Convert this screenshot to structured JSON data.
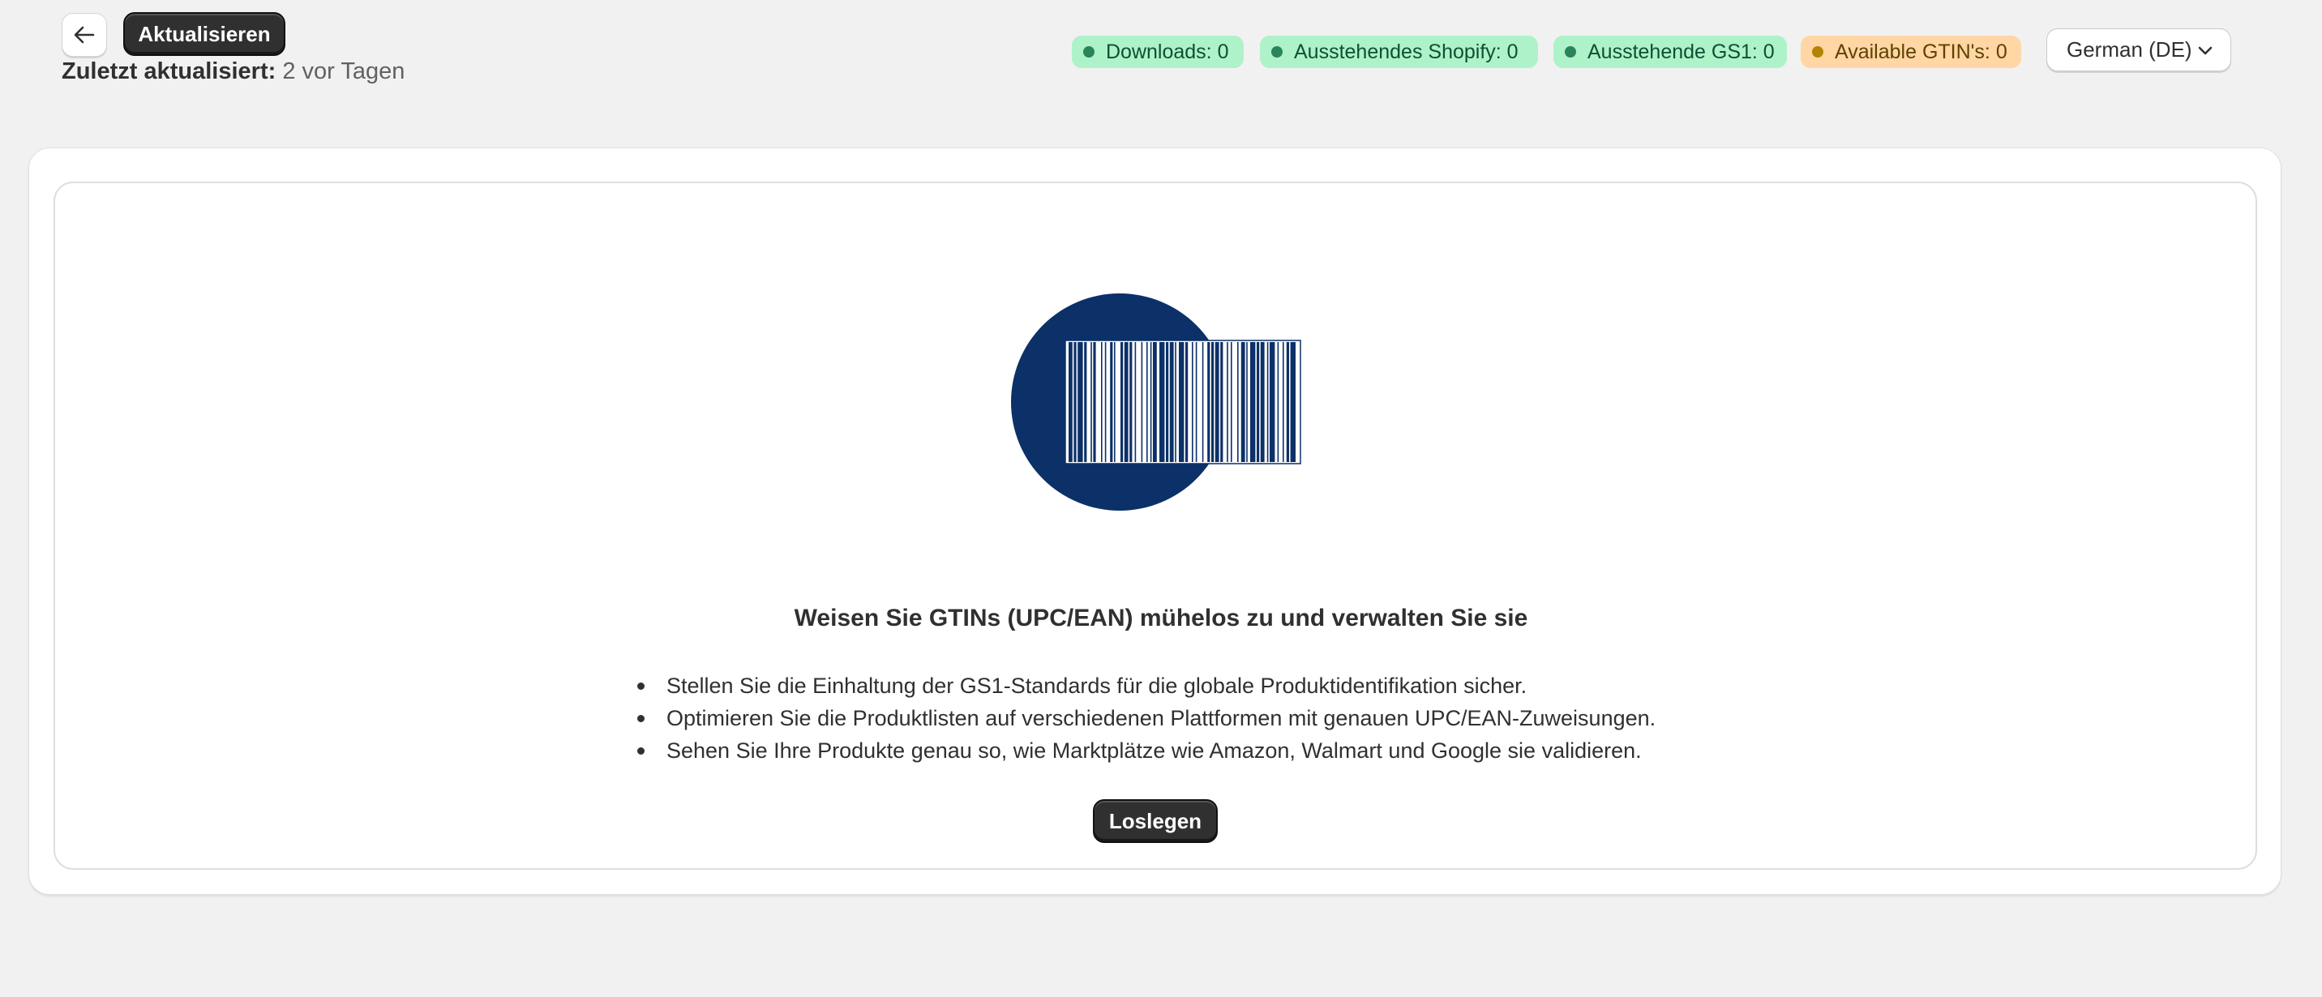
{
  "header": {
    "back_icon": "arrow-left-icon",
    "refresh_label": "Aktualisieren",
    "last_updated_label": "Zuletzt aktualisiert:",
    "last_updated_value": "2 vor Tagen"
  },
  "status_badges": [
    {
      "label": "Downloads: 0",
      "tone": "success",
      "color": "#aef2c9"
    },
    {
      "label": "Ausstehendes Shopify: 0",
      "tone": "success",
      "color": "#aef2c9"
    },
    {
      "label": "Ausstehende GS1: 0",
      "tone": "success",
      "color": "#aef2c9"
    },
    {
      "label": "Available GTIN's: 0",
      "tone": "warning",
      "color": "#ffd6a4"
    }
  ],
  "language_select": {
    "value": "German (DE)",
    "icon": "chevron-down-icon"
  },
  "empty_state": {
    "illustration": "barcode-illustration",
    "illustration_color": "#0c3068",
    "headline": "Weisen Sie GTINs (UPC/EAN) mühelos zu und verwalten Sie sie",
    "features": [
      "Stellen Sie die Einhaltung der GS1-Standards für die globale Produktidentifikation sicher.",
      "Optimieren Sie die Produktlisten auf verschiedenen Plattformen mit genauen UPC/EAN-Zuweisungen.",
      "Sehen Sie Ihre Produkte genau so, wie Marktplätze wie Amazon, Walmart und Google sie validieren."
    ],
    "cta_label": "Loslegen"
  },
  "colors": {
    "background": "#f1f1f1",
    "primary_button": "#303030",
    "success_badge": "#aef2c9",
    "warning_badge": "#ffd6a4"
  }
}
